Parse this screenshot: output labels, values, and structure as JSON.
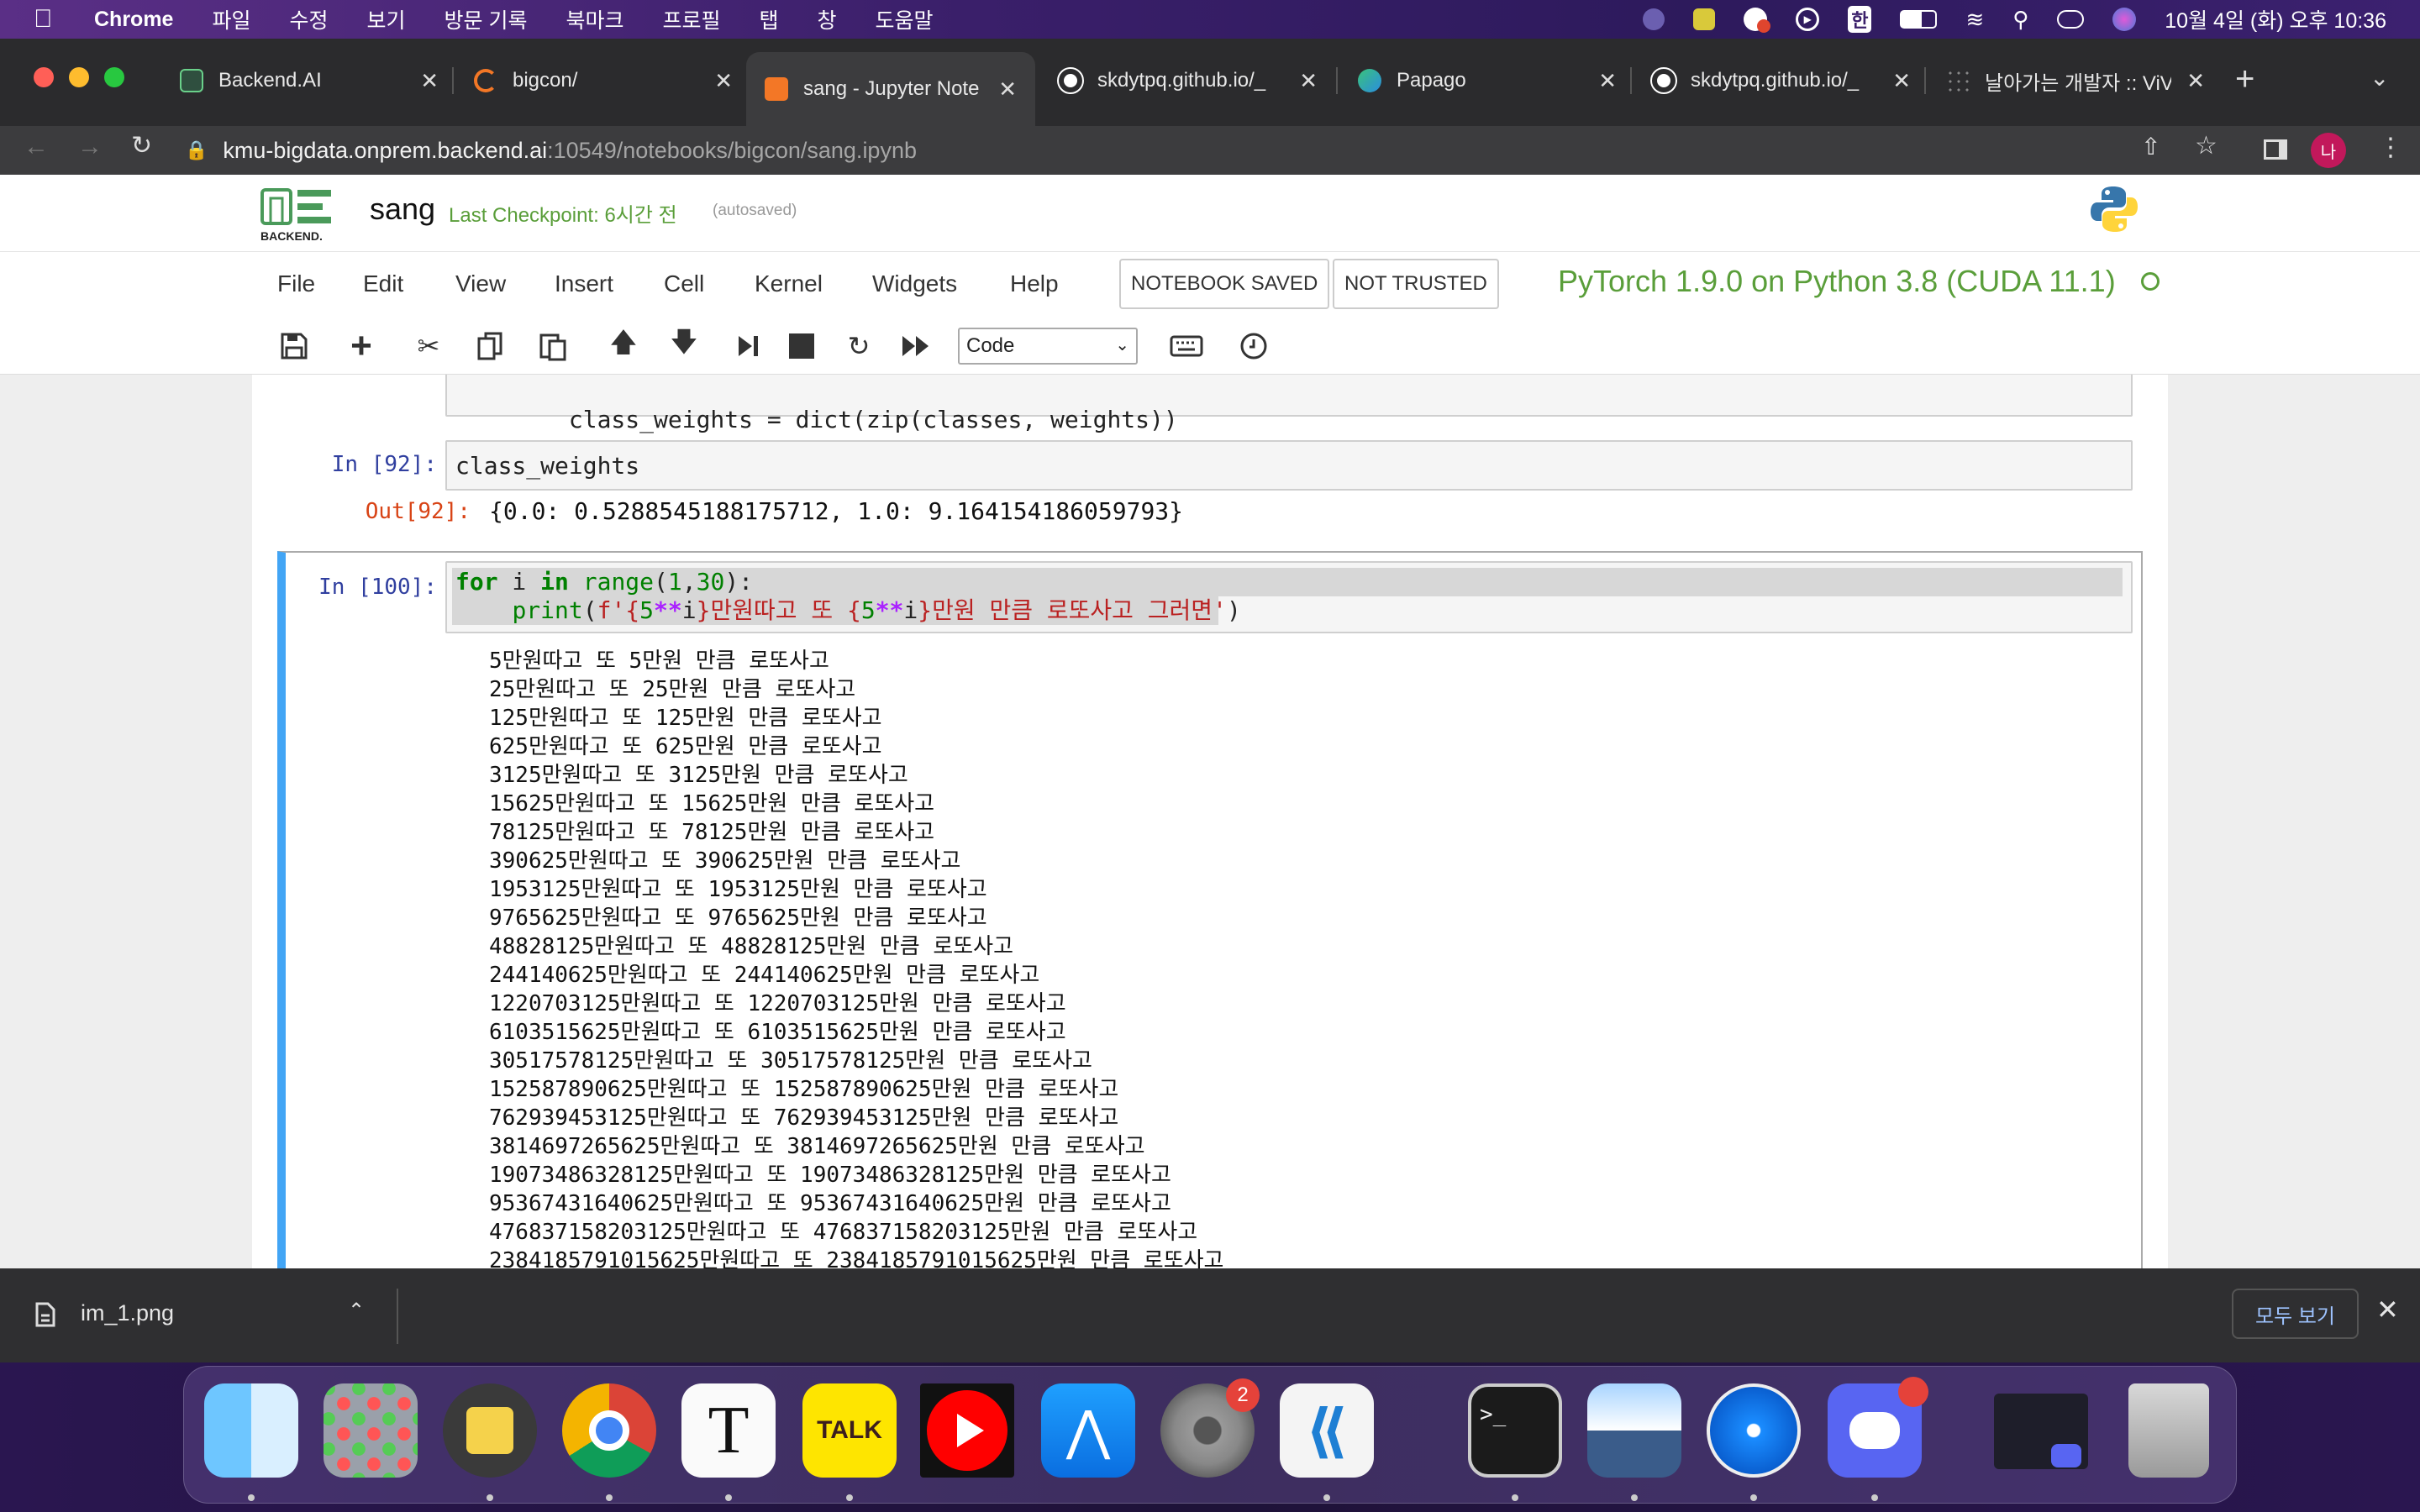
{
  "menubar": {
    "app": "Chrome",
    "items": [
      "파일",
      "수정",
      "보기",
      "방문 기록",
      "북마크",
      "프로필",
      "탭",
      "창",
      "도움말"
    ],
    "clock": "10월 4일 (화) 오후 10:36",
    "input_method": "한"
  },
  "tabs": [
    {
      "title": "Backend.AI",
      "icon": "backend-ai-icon"
    },
    {
      "title": "bigcon/",
      "icon": "jupyter-icon"
    },
    {
      "title": "sang - Jupyter Note",
      "icon": "jupyter-notebook-icon"
    },
    {
      "title": "skdytpq.github.io/_",
      "icon": "github-icon"
    },
    {
      "title": "Papago",
      "icon": "papago-icon"
    },
    {
      "title": "skdytpq.github.io/_",
      "icon": "github-icon"
    },
    {
      "title": "날아가는 개발자 :: ViV",
      "icon": "tistory-icon"
    }
  ],
  "address": {
    "host": "kmu-bigdata.onprem.backend.ai",
    "path": ":10549/notebooks/bigcon/sang.ipynb"
  },
  "profile_initial": "나",
  "jupyter": {
    "logo_text": "BACKEND.",
    "notebook_name": "sang",
    "checkpoint": "Last Checkpoint: 6시간 전",
    "autosaved": "(autosaved)",
    "menu": [
      "File",
      "Edit",
      "View",
      "Insert",
      "Cell",
      "Kernel",
      "Widgets",
      "Help"
    ],
    "notebook_saved": "NOTEBOOK SAVED",
    "not_trusted": "NOT TRUSTED",
    "kernel": "PyTorch 1.9.0 on Python 3.8 (CUDA 11.1)",
    "cell_type": "Code"
  },
  "cells": {
    "partial_line": "class_weights = dict(zip(classes, weights))",
    "c92_prompt": "In [92]:",
    "c92_code": "class_weights",
    "o92_prompt": "Out[92]:",
    "o92_text": "{0.0: 0.5288545188175712, 1.0: 9.164154186059793}",
    "c100_prompt": "In [100]:",
    "c100_code_line1": {
      "kw_for": "for",
      "var": " i ",
      "kw_in": "in",
      "fn": " range",
      "args_open": "(",
      "n1": "1",
      "comma": ",",
      "n2": "30",
      "close": "):"
    },
    "c100_code_line2": {
      "indent": "    ",
      "fn": "print",
      "open": "(",
      "str1": "f'{",
      "n5a": "5",
      "op1": "**",
      "i1": "i",
      "str2": "}만원따고 또 {",
      "n5b": "5",
      "op2": "**",
      "i2": "i",
      "str3": "}만원 만큼 로또사고 그러면'",
      "close": ")"
    },
    "outputs": [
      "5만원따고 또 5만원 만큼 로또사고",
      "25만원따고 또 25만원 만큼 로또사고",
      "125만원따고 또 125만원 만큼 로또사고",
      "625만원따고 또 625만원 만큼 로또사고",
      "3125만원따고 또 3125만원 만큼 로또사고",
      "15625만원따고 또 15625만원 만큼 로또사고",
      "78125만원따고 또 78125만원 만큼 로또사고",
      "390625만원따고 또 390625만원 만큼 로또사고",
      "1953125만원따고 또 1953125만원 만큼 로또사고",
      "9765625만원따고 또 9765625만원 만큼 로또사고",
      "48828125만원따고 또 48828125만원 만큼 로또사고",
      "244140625만원따고 또 244140625만원 만큼 로또사고",
      "1220703125만원따고 또 1220703125만원 만큼 로또사고",
      "6103515625만원따고 또 6103515625만원 만큼 로또사고",
      "30517578125만원따고 또 30517578125만원 만큼 로또사고",
      "152587890625만원따고 또 152587890625만원 만큼 로또사고",
      "762939453125만원따고 또 762939453125만원 만큼 로또사고",
      "3814697265625만원따고 또 3814697265625만원 만큼 로또사고",
      "19073486328125만원따고 또 19073486328125만원 만큼 로또사고",
      "95367431640625만원따고 또 95367431640625만원 만큼 로또사고",
      "476837158203125만원따고 또 476837158203125만원 만큼 로또사고",
      "2384185791015625만원따고 또 2384185791015625만원 만큼 로또사고"
    ]
  },
  "download_shelf": {
    "file": "im_1.png",
    "show_all": "모두 보기"
  },
  "dock": {
    "apps": [
      "finder-icon",
      "launchpad-icon",
      "stickies-icon",
      "chrome-icon",
      "typora-icon",
      "kakaotalk-icon",
      "youtube-music-icon",
      "app-store-icon",
      "system-preferences-icon",
      "vscode-icon",
      "terminal-icon",
      "preview-icon",
      "safari-icon",
      "discord-icon",
      "window-thumbnail-icon",
      "trash-icon"
    ],
    "kakao_label": "TALK",
    "typora_label": "T",
    "settings_badge": "2"
  },
  "colors": {
    "kernel_green": "#5a9e3a",
    "prompt_in": "#303f9f",
    "prompt_out": "#d84315",
    "selected_cell": "#42a5f5"
  }
}
